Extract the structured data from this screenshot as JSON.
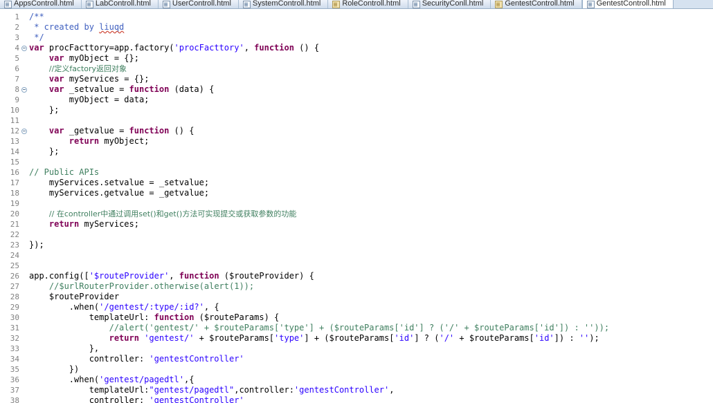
{
  "window": {
    "app": "eclipse-ide-editor"
  },
  "tabbar": {
    "tabs": [
      {
        "label": "AppsControll.html",
        "icon": "html-file-icon",
        "active": false,
        "dirty": false
      },
      {
        "label": "LabControll.html",
        "icon": "html-file-icon",
        "active": false,
        "dirty": false
      },
      {
        "label": "UserControll.html",
        "icon": "html-file-icon",
        "active": false,
        "dirty": false
      },
      {
        "label": "SystemControll.html",
        "icon": "html-file-icon",
        "active": false,
        "dirty": false
      },
      {
        "label": "RoleControll.html",
        "icon": "html-file-icon",
        "active": false,
        "dirty": true
      },
      {
        "label": "SecurityConll.html",
        "icon": "html-file-icon",
        "active": false,
        "dirty": false
      },
      {
        "label": "GentestControll.html",
        "icon": "html-file-icon",
        "active": false,
        "dirty": true
      },
      {
        "label": "GentestControll.html",
        "icon": "js-file-icon",
        "active": true,
        "dirty": false
      }
    ]
  },
  "editor": {
    "first_line": 1,
    "fold_lines": [
      4,
      8,
      12
    ],
    "lines": [
      {
        "n": 1,
        "tokens": [
          {
            "t": "/**",
            "c": "t-cmtblk"
          }
        ]
      },
      {
        "n": 2,
        "tokens": [
          {
            "t": " * created by ",
            "c": "t-cmtblk"
          },
          {
            "t": "liuqd",
            "c": "t-cmtblk spell"
          }
        ]
      },
      {
        "n": 3,
        "tokens": [
          {
            "t": " */",
            "c": "t-cmtblk"
          }
        ]
      },
      {
        "n": 4,
        "tokens": [
          {
            "t": "var",
            "c": "t-kw"
          },
          {
            "t": " procFacttory=app.factory(",
            "c": "t-plain"
          },
          {
            "t": "'procFacttory'",
            "c": "t-str"
          },
          {
            "t": ", ",
            "c": "t-plain"
          },
          {
            "t": "function",
            "c": "t-kw"
          },
          {
            "t": " () {",
            "c": "t-plain"
          }
        ]
      },
      {
        "n": 5,
        "tokens": [
          {
            "t": "    ",
            "c": "t-plain"
          },
          {
            "t": "var",
            "c": "t-kw"
          },
          {
            "t": " myObject = {};",
            "c": "t-plain"
          }
        ]
      },
      {
        "n": 6,
        "tokens": [
          {
            "t": "    ",
            "c": "t-plain"
          },
          {
            "t": "//定义factory返回对象",
            "c": "t-cn"
          }
        ]
      },
      {
        "n": 7,
        "tokens": [
          {
            "t": "    ",
            "c": "t-plain"
          },
          {
            "t": "var",
            "c": "t-kw"
          },
          {
            "t": " myServices = {};",
            "c": "t-plain"
          }
        ]
      },
      {
        "n": 8,
        "tokens": [
          {
            "t": "    ",
            "c": "t-plain"
          },
          {
            "t": "var",
            "c": "t-kw"
          },
          {
            "t": " _setvalue = ",
            "c": "t-plain"
          },
          {
            "t": "function",
            "c": "t-kw"
          },
          {
            "t": " (data) {",
            "c": "t-plain"
          }
        ]
      },
      {
        "n": 9,
        "tokens": [
          {
            "t": "        myObject = data;",
            "c": "t-plain"
          }
        ]
      },
      {
        "n": 10,
        "tokens": [
          {
            "t": "    };",
            "c": "t-plain"
          }
        ]
      },
      {
        "n": 11,
        "tokens": []
      },
      {
        "n": 12,
        "tokens": [
          {
            "t": "    ",
            "c": "t-plain"
          },
          {
            "t": "var",
            "c": "t-kw"
          },
          {
            "t": " _getvalue = ",
            "c": "t-plain"
          },
          {
            "t": "function",
            "c": "t-kw"
          },
          {
            "t": " () {",
            "c": "t-plain"
          }
        ]
      },
      {
        "n": 13,
        "tokens": [
          {
            "t": "        ",
            "c": "t-plain"
          },
          {
            "t": "return",
            "c": "t-kw"
          },
          {
            "t": " myObject;",
            "c": "t-plain"
          }
        ]
      },
      {
        "n": 14,
        "tokens": [
          {
            "t": "    };",
            "c": "t-plain"
          }
        ]
      },
      {
        "n": 15,
        "tokens": []
      },
      {
        "n": 16,
        "tokens": [
          {
            "t": "// Public APIs",
            "c": "t-cmt"
          }
        ]
      },
      {
        "n": 17,
        "tokens": [
          {
            "t": "    myServices.setvalue = _setvalue;",
            "c": "t-plain"
          }
        ]
      },
      {
        "n": 18,
        "tokens": [
          {
            "t": "    myServices.getvalue = _getvalue;",
            "c": "t-plain"
          }
        ]
      },
      {
        "n": 19,
        "tokens": []
      },
      {
        "n": 20,
        "tokens": [
          {
            "t": "    ",
            "c": "t-plain"
          },
          {
            "t": "// 在controller中通过调用set()和get()方法可实现提交或获取参数的功能",
            "c": "t-cn"
          }
        ]
      },
      {
        "n": 21,
        "tokens": [
          {
            "t": "    ",
            "c": "t-plain"
          },
          {
            "t": "return",
            "c": "t-kw"
          },
          {
            "t": " myServices;",
            "c": "t-plain"
          }
        ]
      },
      {
        "n": 22,
        "tokens": []
      },
      {
        "n": 23,
        "tokens": [
          {
            "t": "});",
            "c": "t-plain"
          }
        ]
      },
      {
        "n": 24,
        "tokens": []
      },
      {
        "n": 25,
        "tokens": []
      },
      {
        "n": 26,
        "tokens": [
          {
            "t": "app.config([",
            "c": "t-plain"
          },
          {
            "t": "'$routeProvider'",
            "c": "t-str"
          },
          {
            "t": ", ",
            "c": "t-plain"
          },
          {
            "t": "function",
            "c": "t-kw"
          },
          {
            "t": " ($routeProvider) {",
            "c": "t-plain"
          }
        ]
      },
      {
        "n": 27,
        "tokens": [
          {
            "t": "    ",
            "c": "t-plain"
          },
          {
            "t": "//$urlRouterProvider.otherwise(alert(1));",
            "c": "t-cmt"
          }
        ]
      },
      {
        "n": 28,
        "tokens": [
          {
            "t": "    $routeProvider",
            "c": "t-plain"
          }
        ]
      },
      {
        "n": 29,
        "tokens": [
          {
            "t": "        .when(",
            "c": "t-plain"
          },
          {
            "t": "'/gentest/:type/:id?'",
            "c": "t-str"
          },
          {
            "t": ", {",
            "c": "t-plain"
          }
        ]
      },
      {
        "n": 30,
        "tokens": [
          {
            "t": "            templateUrl: ",
            "c": "t-plain"
          },
          {
            "t": "function",
            "c": "t-kw"
          },
          {
            "t": " ($routeParams) {",
            "c": "t-plain"
          }
        ]
      },
      {
        "n": 31,
        "tokens": [
          {
            "t": "                //alert('gentest/' + $routeParams['type'] + ($routeParams['id'] ? ('/' + $routeParams['id']) : ''));",
            "c": "t-cmt"
          }
        ]
      },
      {
        "n": 32,
        "tokens": [
          {
            "t": "                ",
            "c": "t-plain"
          },
          {
            "t": "return",
            "c": "t-kw"
          },
          {
            "t": " ",
            "c": "t-plain"
          },
          {
            "t": "'gentest/'",
            "c": "t-str"
          },
          {
            "t": " + $routeParams[",
            "c": "t-plain"
          },
          {
            "t": "'type'",
            "c": "t-str"
          },
          {
            "t": "] + ($routeParams[",
            "c": "t-plain"
          },
          {
            "t": "'id'",
            "c": "t-str"
          },
          {
            "t": "] ? (",
            "c": "t-plain"
          },
          {
            "t": "'/'",
            "c": "t-str"
          },
          {
            "t": " + $routeParams[",
            "c": "t-plain"
          },
          {
            "t": "'id'",
            "c": "t-str"
          },
          {
            "t": "]) : ",
            "c": "t-plain"
          },
          {
            "t": "''",
            "c": "t-str"
          },
          {
            "t": ");",
            "c": "t-plain"
          }
        ]
      },
      {
        "n": 33,
        "tokens": [
          {
            "t": "            },",
            "c": "t-plain"
          }
        ]
      },
      {
        "n": 34,
        "tokens": [
          {
            "t": "            controller: ",
            "c": "t-plain"
          },
          {
            "t": "'gentestController'",
            "c": "t-str"
          }
        ]
      },
      {
        "n": 35,
        "tokens": [
          {
            "t": "        })",
            "c": "t-plain"
          }
        ]
      },
      {
        "n": 36,
        "tokens": [
          {
            "t": "        .when(",
            "c": "t-plain"
          },
          {
            "t": "'gentest/pagedtl'",
            "c": "t-str"
          },
          {
            "t": ",{",
            "c": "t-plain"
          }
        ]
      },
      {
        "n": 37,
        "tokens": [
          {
            "t": "            templateUrl:",
            "c": "t-plain"
          },
          {
            "t": "\"gentest/pagedtl\"",
            "c": "t-str"
          },
          {
            "t": ",controller:",
            "c": "t-plain"
          },
          {
            "t": "'gentestController'",
            "c": "t-str"
          },
          {
            "t": ",",
            "c": "t-plain"
          }
        ]
      },
      {
        "n": 38,
        "tokens": [
          {
            "t": "            controller: ",
            "c": "t-plain"
          },
          {
            "t": "'gentestController'",
            "c": "t-str"
          }
        ]
      }
    ]
  }
}
